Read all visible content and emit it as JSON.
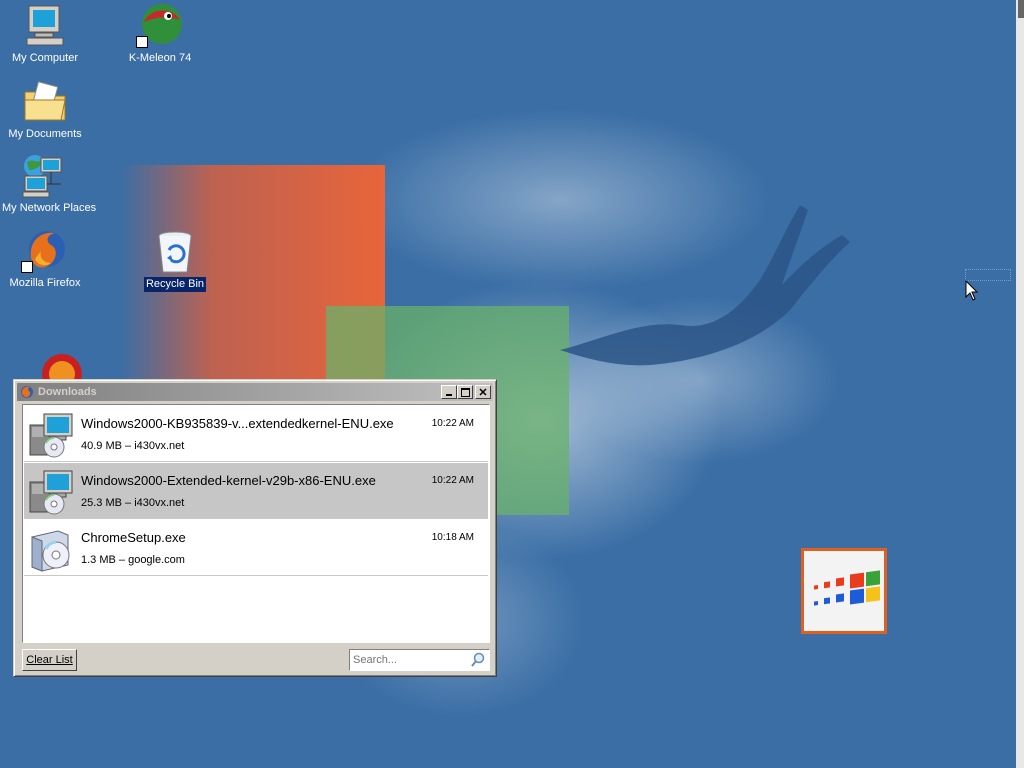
{
  "desktop": {
    "icons": [
      {
        "label": "My Computer",
        "icon": "my-computer-icon"
      },
      {
        "label": "K-Meleon 74",
        "icon": "k-meleon-icon"
      },
      {
        "label": "My Documents",
        "icon": "my-documents-icon"
      },
      {
        "label": "My Network Places",
        "icon": "network-places-icon"
      },
      {
        "label": "Mozilla Firefox",
        "icon": "firefox-icon"
      },
      {
        "label": "Recycle Bin",
        "icon": "recycle-bin-icon"
      }
    ]
  },
  "downloads": {
    "title": "Downloads",
    "items": [
      {
        "filename": "Windows2000-KB935839-v...extendedkernel-ENU.exe",
        "meta": "40.9 MB – i430vx.net",
        "time": "10:22 AM",
        "icon": "installer-icon"
      },
      {
        "filename": "Windows2000-Extended-kernel-v29b-x86-ENU.exe",
        "meta": "25.3 MB – i430vx.net",
        "time": "10:22 AM",
        "icon": "installer-icon"
      },
      {
        "filename": "ChromeSetup.exe",
        "meta": "1.3 MB – google.com",
        "time": "10:18 AM",
        "icon": "setup-cd-icon"
      }
    ],
    "clear_label": "Clear List",
    "search_placeholder": "Search..."
  },
  "colors": {
    "desktop": "#3a6ea5",
    "selected_row": "#c6c6c6",
    "title_gradient_start": "#808080",
    "logo_border": "#e06020"
  }
}
